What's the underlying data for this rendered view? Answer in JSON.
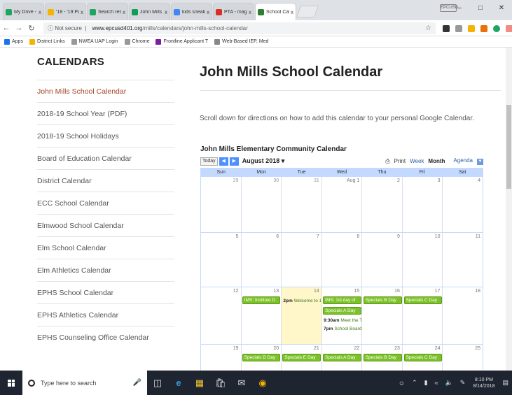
{
  "browser": {
    "tabs": [
      {
        "label": "My Drive - Goog",
        "color": "#1fa463"
      },
      {
        "label": "'18 - '19 Parent",
        "color": "#f4b400"
      },
      {
        "label": "Search results -",
        "color": "#1fa463"
      },
      {
        "label": "John Mills Maste",
        "color": "#0f9d58"
      },
      {
        "label": "kids sneakers - ",
        "color": "#4285f4"
      },
      {
        "label": "PTA - magruder",
        "color": "#d93025"
      },
      {
        "label": "School Calenda",
        "color": "#2e7d32"
      }
    ],
    "tab_close": "x",
    "account_badge": "EPCUSD",
    "address": {
      "security": "Not secure",
      "domain": "www.epcusd401.org",
      "path": "/mills/calendars/john-mills-school-calendar"
    },
    "bookmarks": [
      {
        "label": "Apps",
        "color": "#1a73e8"
      },
      {
        "label": "District Links",
        "color": "#f4b400"
      },
      {
        "label": "NWEA UAP Login",
        "color": "#999999"
      },
      {
        "label": "Chrome",
        "color": "#999999"
      },
      {
        "label": "Frontline Applicant T",
        "color": "#7b1fa2"
      },
      {
        "label": "Web-Based IEP, Med",
        "color": "#888888"
      }
    ]
  },
  "sidebar": {
    "title": "CALENDARS",
    "items": [
      {
        "label": "John Mills School Calendar",
        "active": true
      },
      {
        "label": "2018-19 School Year (PDF)"
      },
      {
        "label": "2018-19 School Holidays"
      },
      {
        "label": "Board of Education Calendar"
      },
      {
        "label": "District Calendar"
      },
      {
        "label": "ECC School Calendar"
      },
      {
        "label": "Elmwood School Calendar"
      },
      {
        "label": "Elm School Calendar"
      },
      {
        "label": "Elm Athletics Calendar"
      },
      {
        "label": "EPHS School Calendar"
      },
      {
        "label": "EPHS Athletics Calendar"
      },
      {
        "label": "EPHS Counseling Office Calendar"
      }
    ]
  },
  "main": {
    "title": "John Mills School Calendar",
    "intro": "Scroll down for directions on how to add this calendar to your personal Google Calendar."
  },
  "calendar": {
    "title": "John Mills Elementary Community Calendar",
    "today_btn": "Today",
    "month": "August 2018",
    "print": "Print",
    "views": [
      "Week",
      "Month",
      "Agenda"
    ],
    "selected_view": "Month",
    "weekdays": [
      "Sun",
      "Mon",
      "Tue",
      "Wed",
      "Thu",
      "Fri",
      "Sat"
    ],
    "weeks": [
      {
        "days": [
          "29",
          "30",
          "31",
          "Aug 1",
          "2",
          "3",
          "4"
        ],
        "height": 80
      },
      {
        "days": [
          "5",
          "6",
          "7",
          "8",
          "9",
          "10",
          "11"
        ],
        "height": 78
      },
      {
        "days": [
          "12",
          "13",
          "14",
          "15",
          "16",
          "17",
          "18"
        ],
        "height": 82
      },
      {
        "days": [
          "19",
          "20",
          "21",
          "22",
          "23",
          "24",
          "25"
        ],
        "height": 40
      }
    ],
    "events": {
      "week3": {
        "mon": "IMS: Institute D",
        "tue_time": "2pm",
        "tue": "Welcome to 1",
        "wed_allday": "IMS: 1st day of",
        "thu": "Specials B Day",
        "fri": "Specials C Day",
        "wed2": "Specials A Day",
        "wed3_time": "9:30am",
        "wed3": "Meet the T",
        "wed4_time": "7pm",
        "wed4": "School Board"
      },
      "week4": [
        "Specials D Day",
        "Specials E Day",
        "Specials A Day",
        "Specials B Day",
        "Specials C Day"
      ]
    }
  },
  "taskbar": {
    "search_placeholder": "Type here to search",
    "time": "8:10 PM",
    "date": "8/14/2018"
  }
}
